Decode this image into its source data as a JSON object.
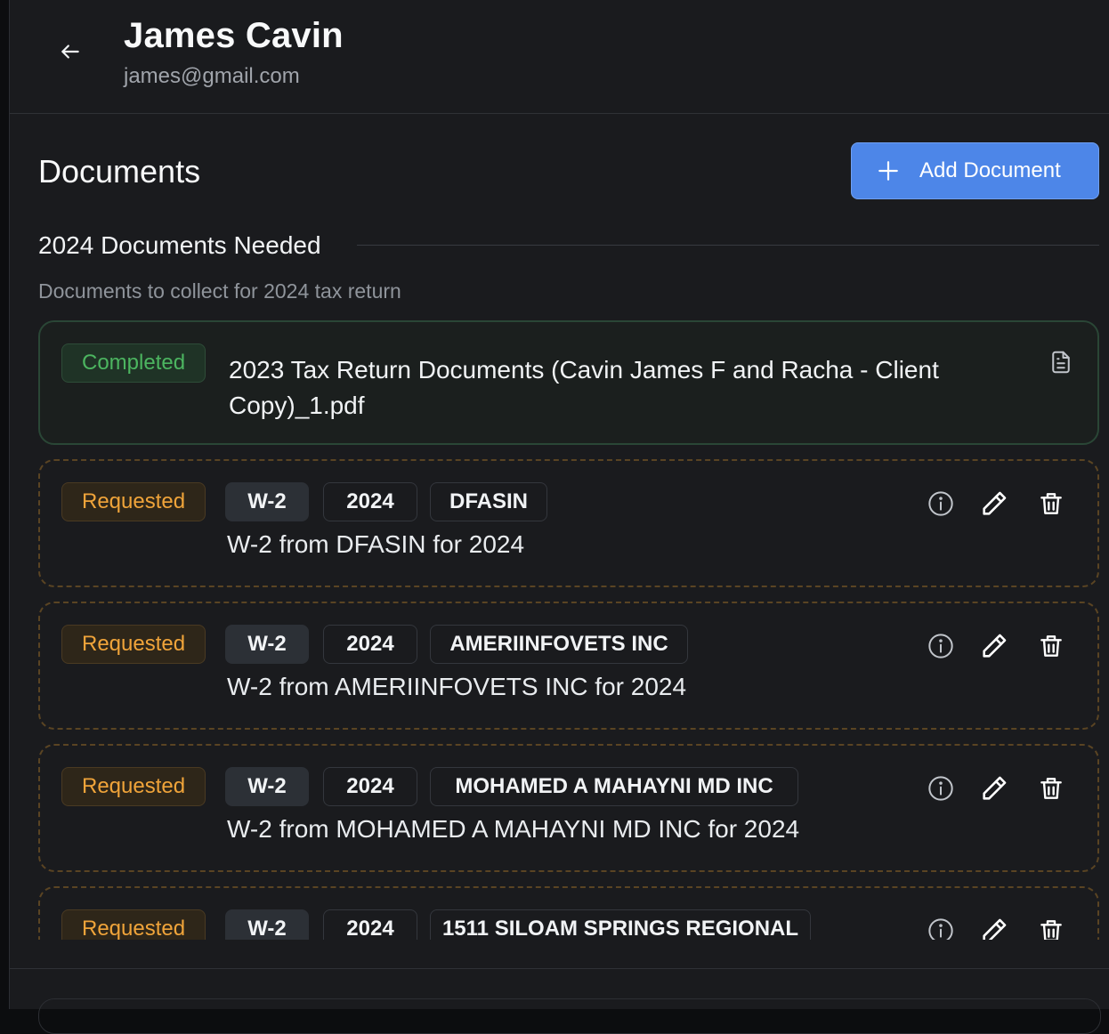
{
  "client": {
    "name": "James Cavin",
    "email": "james@gmail.com"
  },
  "section": {
    "title": "Documents",
    "add_button_label": "Add Document"
  },
  "group": {
    "title": "2024 Documents Needed",
    "subtitle": "Documents to collect for 2024 tax return"
  },
  "completed_doc": {
    "status": "Completed",
    "title": "2023 Tax Return Documents (Cavin James F and Racha - Client Copy)_1.pdf"
  },
  "requested_docs": [
    {
      "status": "Requested",
      "type": "W-2",
      "year": "2024",
      "employer": "DFASIN",
      "description": "W-2 from DFASIN for 2024"
    },
    {
      "status": "Requested",
      "type": "W-2",
      "year": "2024",
      "employer": "AMERIINFOVETS INC",
      "description": "W-2 from AMERIINFOVETS INC for 2024"
    },
    {
      "status": "Requested",
      "type": "W-2",
      "year": "2024",
      "employer": "MOHAMED A MAHAYNI MD INC",
      "description": "W-2 from MOHAMED A MAHAYNI MD INC for 2024"
    },
    {
      "status": "Requested",
      "type": "W-2",
      "year": "2024",
      "employer": "1511 SILOAM SPRINGS REGIONAL",
      "description": ""
    }
  ],
  "icons": {
    "back": "arrow-left-icon",
    "add": "plus-icon",
    "file": "file-text-icon",
    "info": "info-circle-icon",
    "edit": "pencil-icon",
    "delete": "trash-icon"
  },
  "colors": {
    "background": "#1a1b1e",
    "accent": "#4d86e8",
    "completed": "#4cb560",
    "requested": "#f0a43a"
  }
}
